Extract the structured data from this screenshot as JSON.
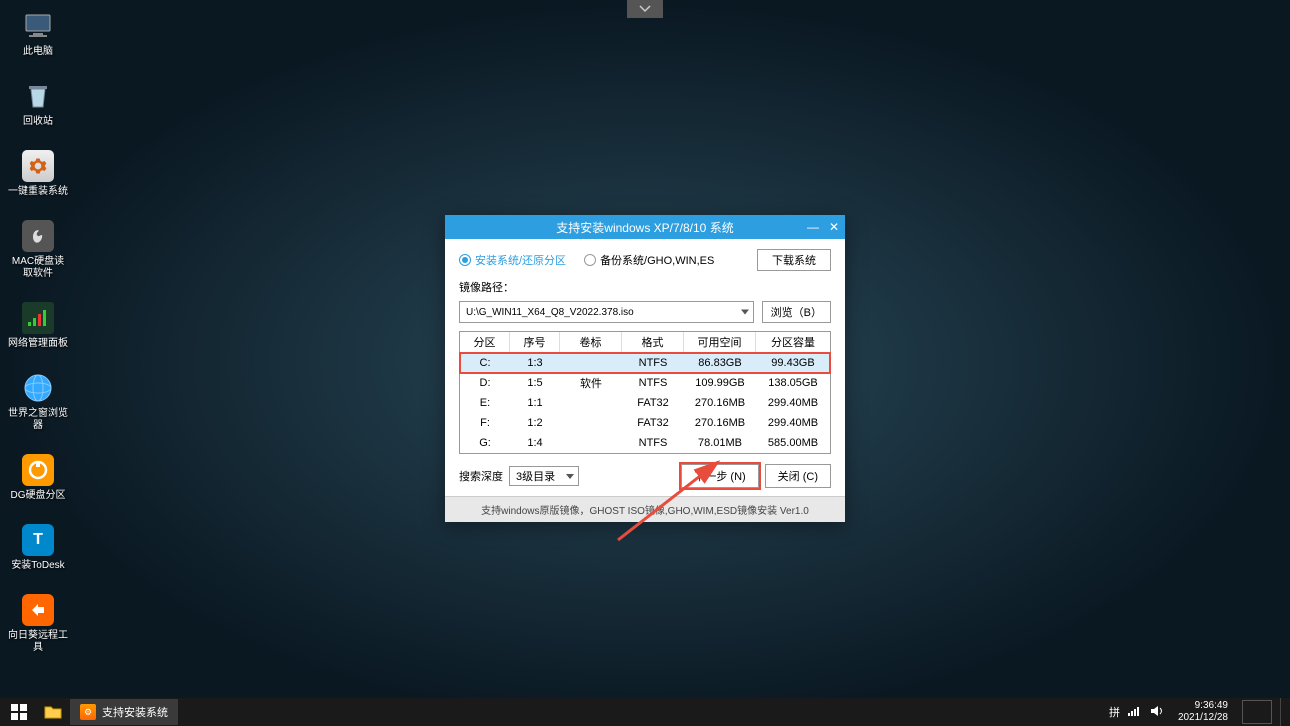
{
  "top_tab": "v",
  "desktop": {
    "items": [
      {
        "label": "此电脑"
      },
      {
        "label": "回收站"
      },
      {
        "label": "一键重装系统"
      },
      {
        "label": "MAC硬盘读取软件"
      },
      {
        "label": "网络管理面板"
      },
      {
        "label": "世界之窗浏览器"
      },
      {
        "label": "DG硬盘分区"
      },
      {
        "label": "安装ToDesk"
      },
      {
        "label": "向日葵远程工具"
      }
    ]
  },
  "dialog": {
    "title": "支持安装windows XP/7/8/10 系统",
    "radio_install": "安装系统/还原分区",
    "radio_backup": "备份系统/GHO,WIN,ES",
    "download_btn": "下载系统",
    "path_label": "镜像路径：",
    "path_value": "U:\\G_WIN11_X64_Q8_V2022.378.iso",
    "browse_btn": "浏览（B）",
    "headers": {
      "c1": "分区",
      "c2": "序号",
      "c3": "卷标",
      "c4": "格式",
      "c5": "可用空间",
      "c6": "分区容量"
    },
    "rows": [
      {
        "c1": "C:",
        "c2": "1:3",
        "c3": "",
        "c4": "NTFS",
        "c5": "86.83GB",
        "c6": "99.43GB"
      },
      {
        "c1": "D:",
        "c2": "1:5",
        "c3": "软件",
        "c4": "NTFS",
        "c5": "109.99GB",
        "c6": "138.05GB"
      },
      {
        "c1": "E:",
        "c2": "1:1",
        "c3": "",
        "c4": "FAT32",
        "c5": "270.16MB",
        "c6": "299.40MB"
      },
      {
        "c1": "F:",
        "c2": "1:2",
        "c3": "",
        "c4": "FAT32",
        "c5": "270.16MB",
        "c6": "299.40MB"
      },
      {
        "c1": "G:",
        "c2": "1:4",
        "c3": "",
        "c4": "NTFS",
        "c5": "78.01MB",
        "c6": "585.00MB"
      }
    ],
    "search_depth_label": "搜索深度",
    "search_depth_value": "3级目录",
    "next_btn": "下一步 (N)",
    "close_btn": "关闭 (C)",
    "footer": "支持windows原版镜像，GHOST ISO镜像,GHO,WIM,ESD镜像安装 Ver1.0"
  },
  "taskbar": {
    "app_label": "支持安装系统",
    "time": "9:36:49",
    "date": "2021/12/28"
  }
}
